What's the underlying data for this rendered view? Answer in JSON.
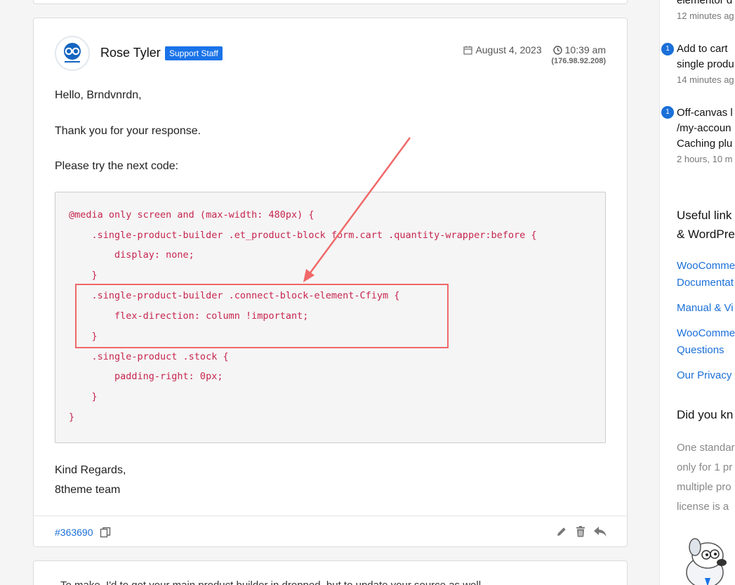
{
  "reply": {
    "author": "Rose Tyler",
    "badge": "Support Staff",
    "date": "August 4, 2023",
    "time": "10:39 am",
    "ip": "(176.98.92.208)",
    "greeting": "Hello, Brndvnrdn,",
    "line1": "Thank you for your response.",
    "line2": "Please try the next code:",
    "code": [
      "@media only screen and (max-width: 480px) {",
      "    .single-product-builder .et_product-block form.cart .quantity-wrapper:before {",
      "        display: none;",
      "    }",
      "    .single-product-builder .connect-block-element-Cfiym {",
      "        flex-direction: column !important;",
      "    }",
      "    .single-product .stock {",
      "        padding-right: 0px;",
      "    }",
      "}"
    ],
    "sign1": "Kind Regards,",
    "sign2": "8theme team",
    "ticket_id": "#363690"
  },
  "next_card": {
    "preview": "To make, I'd to get your main product builder in dropped, but to update your source as well..."
  },
  "sidebar": {
    "top_line": "elementor d",
    "top_time": "12 minutes ag",
    "items": [
      {
        "badge": "1",
        "lines": [
          "Add to cart",
          "single produ"
        ],
        "time": "14 minutes ag"
      },
      {
        "badge": "1",
        "lines": [
          "Off-canvas l",
          "/my-accoun",
          "Caching plu"
        ],
        "time": "2 hours, 10 m"
      }
    ],
    "useful_heading": [
      "Useful link",
      "& WordPre"
    ],
    "links": [
      [
        "WooComme",
        "Documentat"
      ],
      [
        "Manual & Vi"
      ],
      [
        "WooComme",
        "Questions"
      ],
      [
        "Our Privacy"
      ]
    ],
    "did_you_know": "Did you kn",
    "tip_lines": [
      "One standar",
      "only for 1 pr",
      "multiple pro",
      "license is a"
    ]
  },
  "colors": {
    "accent": "#1a73e8",
    "link": "#1a6fd8",
    "code": "#c7254e",
    "highlight": "#f06868"
  }
}
